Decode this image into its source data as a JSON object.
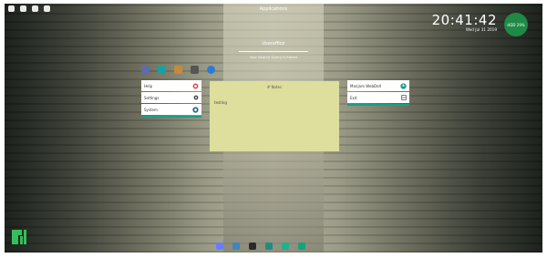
{
  "topbar": {
    "title": "Applications",
    "icons": [
      "telegram-icon",
      "pin-icon",
      "volume-icon",
      "window-icon"
    ]
  },
  "clock": {
    "time": "20:41:42",
    "date": "Wed Jul 31 2019"
  },
  "disk": {
    "label": "HDD",
    "percent": "29%"
  },
  "user": {
    "name": "Useroffice",
    "search_hint": "Your Search Query Is Saved"
  },
  "favorites": [
    "globe-icon",
    "terminal-icon",
    "archive-icon",
    "settings-app-icon",
    "info-icon"
  ],
  "left_menu": [
    {
      "label": "Help",
      "icon": "help-icon"
    },
    {
      "label": "Settings",
      "icon": "gear-icon"
    },
    {
      "label": "System",
      "icon": "gear-icon"
    }
  ],
  "right_menu": [
    {
      "label": "Manjaro WebDeX",
      "icon": "user-icon"
    },
    {
      "label": "Exit",
      "icon": "exit-icon"
    }
  ],
  "notes": {
    "title": "# Notes",
    "content": "testing"
  },
  "dock": [
    "file-manager-icon",
    "app-icon",
    "terminal-icon",
    "monitor-icon",
    "green-app-icon",
    "green-app-icon"
  ],
  "colors": {
    "accent": "#15a085",
    "note": "#dede9d",
    "hdd": "#1e8a45",
    "manjaro": "#35bf5c"
  }
}
